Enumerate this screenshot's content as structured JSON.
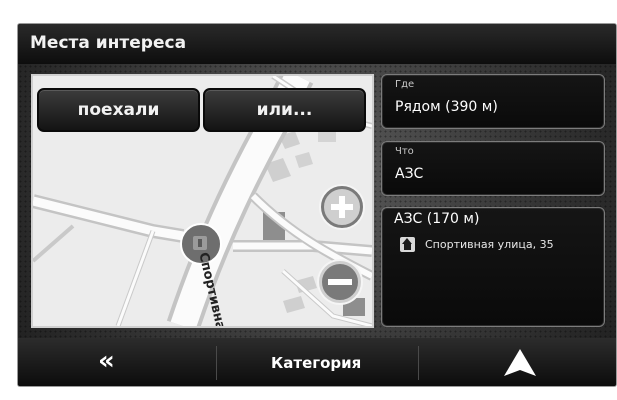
{
  "header": {
    "title": "Места интереса"
  },
  "map": {
    "go_button": "поехали",
    "or_button": "или...",
    "street_label": "Спортивна"
  },
  "where": {
    "label": "Где",
    "value": "Рядом (390 м)"
  },
  "what": {
    "label": "Что",
    "value": "АЗС"
  },
  "result": {
    "title": "АЗС (170 м)",
    "address": "Спортивная улица, 35"
  },
  "bottom": {
    "back_glyph": "«",
    "category": "Категория"
  },
  "icons": {
    "zoom_in": "zoom-in-icon",
    "zoom_out": "zoom-out-icon",
    "home": "home-icon",
    "navigate": "navigation-arrow-icon",
    "back": "double-chevron-left-icon"
  }
}
